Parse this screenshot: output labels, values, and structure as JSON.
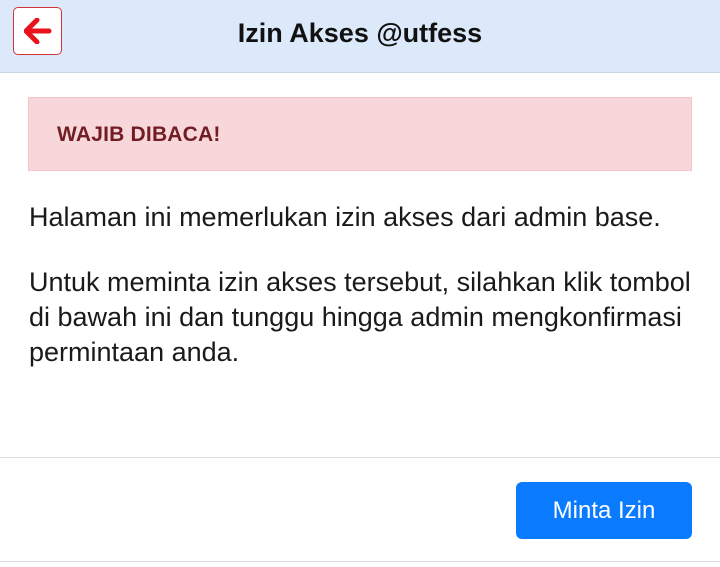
{
  "header": {
    "title": "Izin Akses @utfess",
    "back_icon": "arrow-left-icon",
    "back_icon_color": "#e8121b"
  },
  "warning": {
    "text": "WAJIB DIBACA!",
    "background": "#f8d7da",
    "text_color": "#721c24"
  },
  "content": {
    "paragraph_1": "Halaman ini memerlukan izin akses dari admin base.",
    "paragraph_2": "Untuk meminta izin akses tersebut, silahkan klik tombol di bawah ini dan tunggu hingga admin mengkonfirmasi permintaan anda."
  },
  "footer": {
    "request_button_label": "Minta Izin",
    "button_color": "#0a7bff"
  }
}
